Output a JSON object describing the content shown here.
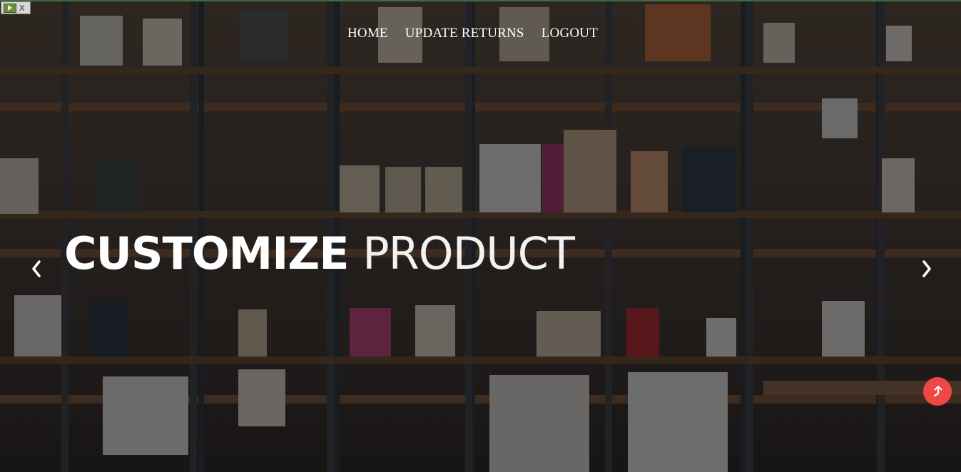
{
  "nav": {
    "items": [
      {
        "label": "HOME"
      },
      {
        "label": "UPDATE RETURNS"
      },
      {
        "label": "LOGOUT"
      }
    ]
  },
  "hero": {
    "title_bold": "CUSTOMIZE",
    "title_light": "PRODUCT"
  },
  "icons": {
    "prev": "chevron-left-icon",
    "next": "chevron-right-icon",
    "scroll_top": "arrow-up-icon",
    "plugin": "plugin-toolbar-icon"
  },
  "colors": {
    "scroll_top_button": "#ef4646",
    "text": "#ffffff"
  }
}
